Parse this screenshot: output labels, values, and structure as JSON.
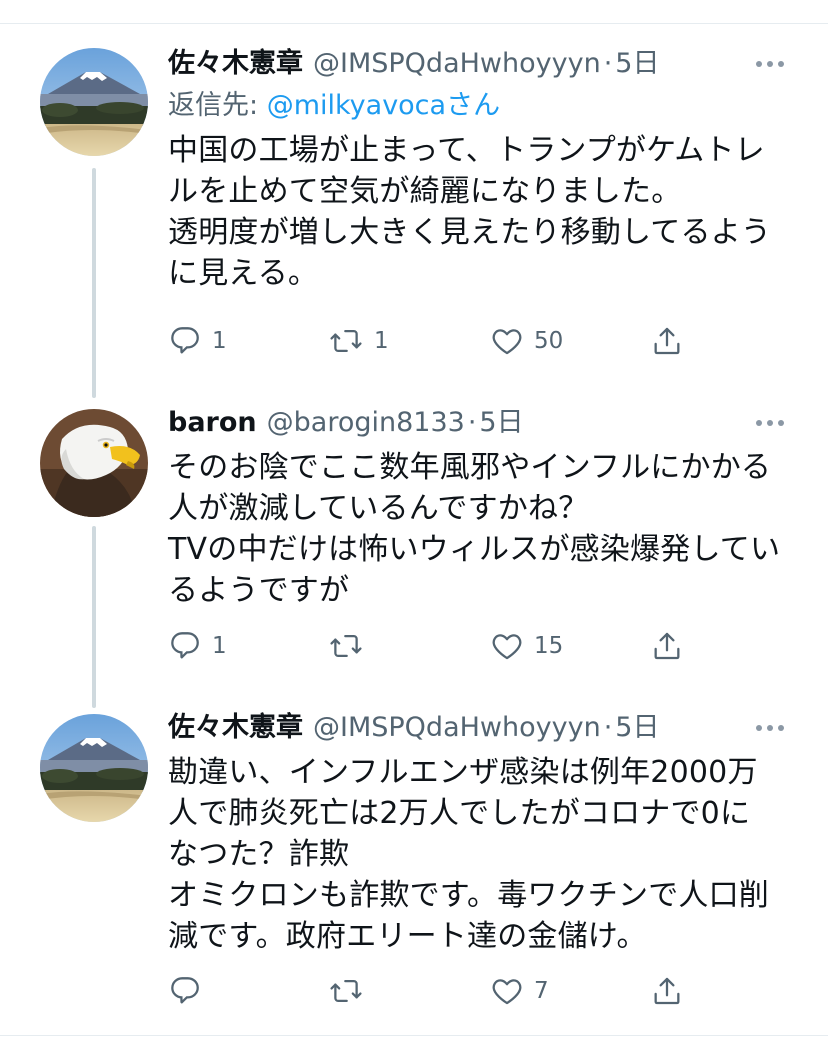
{
  "tweets": [
    {
      "name": "佐々木憲章",
      "handle": "@IMSPQdaHwhoyyyn",
      "separator": "·",
      "time": "5日",
      "reply_prefix": "返信先: ",
      "reply_mention": "@milkyavoca",
      "reply_suffix": "さん",
      "lines": [
        "中国の工場が止まって、トランプがケムトレ",
        "ルを止めて空気が綺麗になりました。",
        "透明度が増し大きく見えたり移動してるよう",
        "に見える。"
      ],
      "replies": "1",
      "retweets": "1",
      "likes": "50",
      "avatar": "mount-fuji-photo"
    },
    {
      "name": "baron",
      "handle": "@barogin8133",
      "separator": "·",
      "time": "5日",
      "lines": [
        "そのお陰でここ数年風邪やインフルにかかる",
        "人が激減しているんですかね？",
        "TVの中だけは怖いウィルスが感染爆発してい",
        "るようですが"
      ],
      "replies": "1",
      "retweets": "",
      "likes": "15",
      "avatar": "bald-eagle-photo"
    },
    {
      "name": "佐々木憲章",
      "handle": "@IMSPQdaHwhoyyyn",
      "separator": "·",
      "time": "5日",
      "lines": [
        "勘違い、インフルエンザ感染は例年2000万",
        "人で肺炎死亡は2万人でしたがコロナで0に",
        "なつた？詐欺",
        "オミクロンも詐欺です。毒ワクチンで人口削",
        "減です。政府エリート達の金儲け。"
      ],
      "replies": "",
      "retweets": "",
      "likes": "7",
      "avatar": "mount-fuji-photo"
    }
  ],
  "icons": {
    "reply": "speech-bubble-icon",
    "retweet": "retweet-arrows-icon",
    "like": "heart-outline-icon",
    "share": "upload-share-icon",
    "more": "three-dots-icon"
  },
  "colors": {
    "text": "#0f1419",
    "secondary": "#536471",
    "mention": "#1d9bf0",
    "thread_line": "#cfd9de",
    "divider": "#e6ecf0"
  }
}
